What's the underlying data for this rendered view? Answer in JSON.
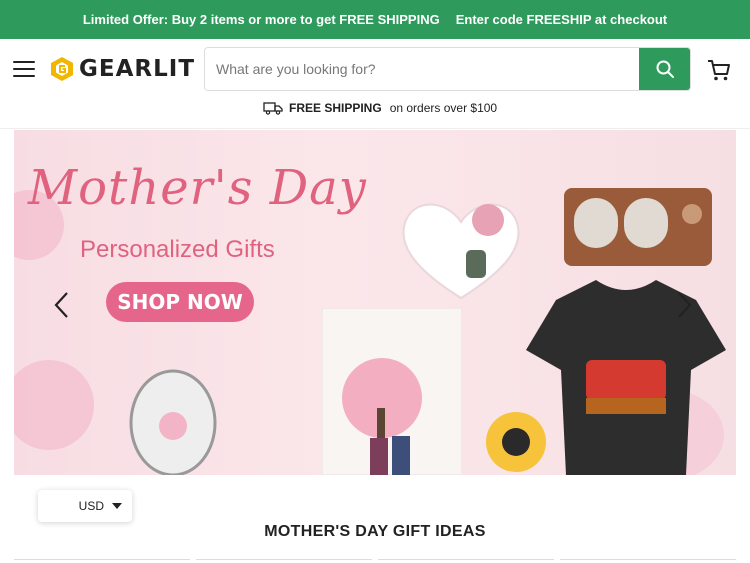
{
  "promo": {
    "offer": "Limited Offer: Buy 2 items or more to get FREE SHIPPING",
    "code": "Enter code FREESHIP at checkout"
  },
  "header": {
    "logo_text": "GEARLIT",
    "search_placeholder": "What are you looking for?",
    "shipping_strong": "FREE SHIPPING",
    "shipping_rest": "on orders over $100"
  },
  "hero": {
    "script_title": "Mother's Day",
    "subtitle": "Personalized Gifts",
    "cta": "SHOP NOW"
  },
  "currency": {
    "selected": "USD"
  },
  "section": {
    "title": "MOTHER'S DAY GIFT IDEAS"
  },
  "colors": {
    "brand_green": "#2e9a5c",
    "hero_pink": "#e0627f",
    "cta_pink": "#e5668a"
  }
}
